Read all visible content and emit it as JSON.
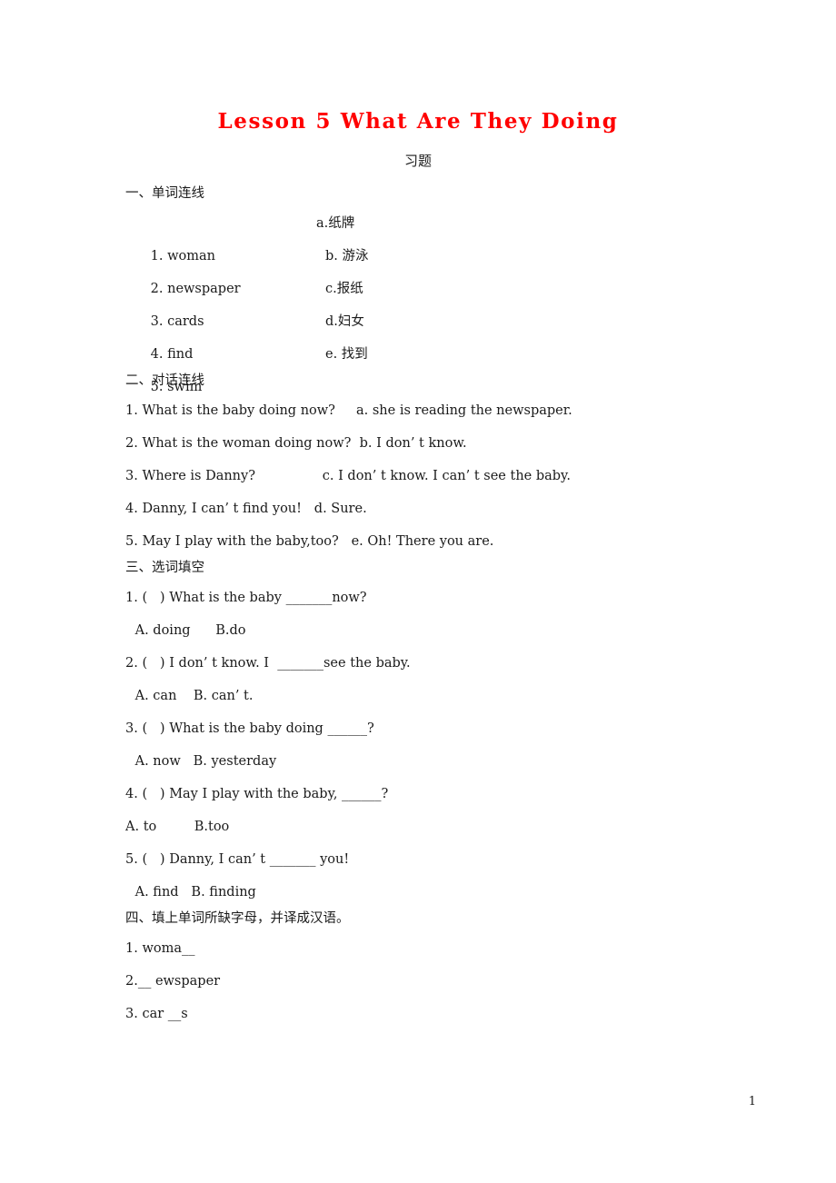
{
  "document": {
    "title": "Lesson 5 What Are They Doing",
    "subtitle": "习题",
    "page_number": "1",
    "title_color": "#ff0000"
  },
  "section1": {
    "heading": "一、单词连线",
    "rows": [
      {
        "term": "1. woman",
        "answer": "a.纸牌"
      },
      {
        "term": "2. newspaper",
        "answer": "b. 游泳"
      },
      {
        "term": "3. cards",
        "answer": "c.报纸"
      },
      {
        "term": "4. find",
        "answer": "d.妇女"
      },
      {
        "term": "5. swim",
        "answer": "e. 找到"
      }
    ]
  },
  "section2": {
    "heading": "二、对话连线",
    "lines": [
      "1. What is the baby doing now?     a. she is reading the newspaper.",
      "2. What is the woman doing now?  b. I don’ t know.",
      "3. Where is Danny?                c. I don’ t know. I can’ t see the baby.",
      "4. Danny, I can’ t find you!   d. Sure.",
      "5. May I play with the baby,too?   e. Oh! There you are."
    ]
  },
  "section3": {
    "heading": "三、选词填空",
    "items": [
      {
        "question": "1. (   ) What is the baby _______now?",
        "options": " A. doing      B.do",
        "option_indent": true
      },
      {
        "question": "2. (   ) I don’ t know. I  _______see the baby.",
        "options": " A. can    B. can’ t.",
        "option_indent": true
      },
      {
        "question": "3. (   ) What is the baby doing ______?",
        "options": " A. now   B. yesterday",
        "option_indent": true
      },
      {
        "question": "4. (   ) May I play with the baby, ______?",
        "options": "A. to         B.too",
        "option_indent": false
      },
      {
        "question": "5. (   ) Danny, I can’ t _______ you!",
        "options": " A. find   B. finding",
        "option_indent": true
      }
    ]
  },
  "section4": {
    "heading": "四、填上单词所缺字母，并译成汉语。",
    "items": [
      "1. woma__",
      "2.__ ewspaper",
      "3. car __s"
    ]
  }
}
